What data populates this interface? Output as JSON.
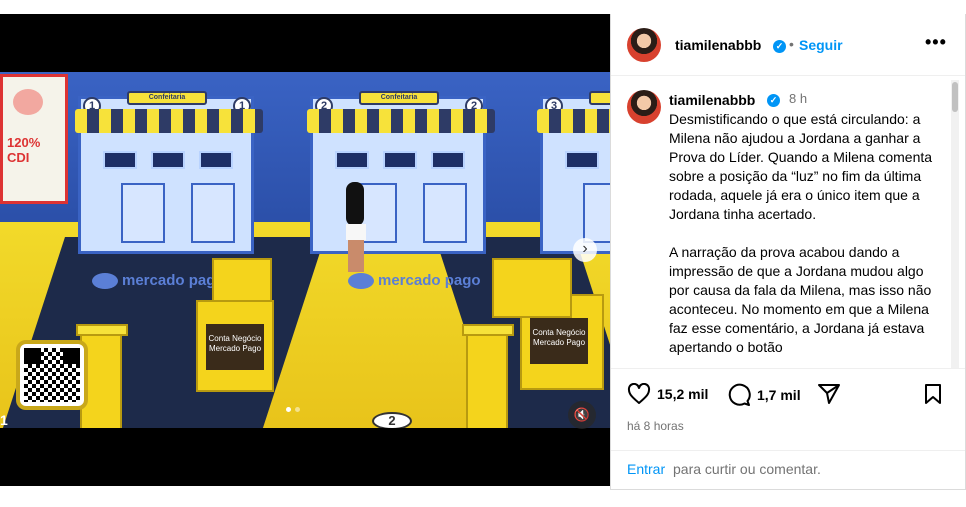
{
  "post": {
    "username": "tiamilenabbb",
    "follow_label": "Seguir",
    "separator": "•",
    "more_label": "•••",
    "verified_mark": "✓"
  },
  "caption": {
    "username": "tiamilenabbb",
    "time": "8 h",
    "text": "Desmistificando o que está circulando: a Milena não ajudou a Jordana a ganhar a Prova do Líder. Quando a Milena comenta sobre a posição da “luz” no fim da última rodada, aquele já era o único item que a Jordana tinha acertado.\n\nA narração da prova acabou dando a impressão de que a Jordana mudou algo por causa da fala da Milena, mas isso não aconteceu. No momento em que a Milena faz esse comentário, a Jordana já estava apertando o botão"
  },
  "actions": {
    "likes": "15,2 mil",
    "comments": "1,7 mil",
    "posted": "há 8 horas"
  },
  "login": {
    "link": "Entrar",
    "rest": "para curtir ou comentar."
  },
  "media": {
    "board_text": "120%\nCDI",
    "stall_sign": "Confeitaria",
    "stall_numbers": [
      "1",
      "2",
      "3"
    ],
    "box_label": "Conta Negócio\nMercado Pago",
    "logo_text": "mercado\npago",
    "floor_numbers": [
      "1",
      "2"
    ],
    "next_icon": "›",
    "mute_icon": "🔇"
  },
  "colors": {
    "accent": "#0095f6",
    "scene_yellow": "#f4d41c",
    "scene_blue": "#3a63c4"
  }
}
